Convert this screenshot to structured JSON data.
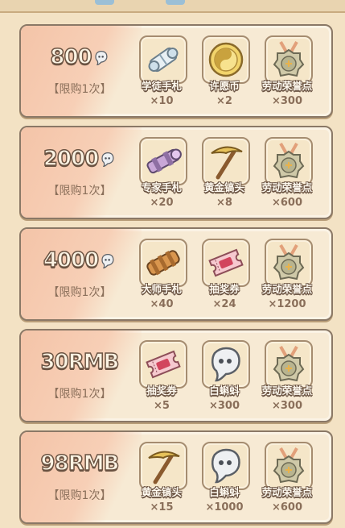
{
  "packs": [
    {
      "price": "800",
      "limit": "【限购1次】",
      "rewards": [
        {
          "icon": "scroll-icon",
          "name": "学徒手札",
          "qty": "×10"
        },
        {
          "icon": "coin-icon",
          "name": "许愿币",
          "qty": "×2"
        },
        {
          "icon": "medal-icon",
          "name": "劳动荣誉点",
          "qty": "×300"
        }
      ]
    },
    {
      "price": "2000",
      "limit": "【限购1次】",
      "rewards": [
        {
          "icon": "telescope-icon",
          "name": "专家手札",
          "qty": "×20"
        },
        {
          "icon": "pickaxe-icon",
          "name": "黄金镐头",
          "qty": "×8"
        },
        {
          "icon": "medal-icon",
          "name": "劳动荣誉点",
          "qty": "×600"
        }
      ]
    },
    {
      "price": "4000",
      "limit": "【限购1次】",
      "rewards": [
        {
          "icon": "master-scroll-icon",
          "name": "大师手札",
          "qty": "×40"
        },
        {
          "icon": "ticket-icon",
          "name": "抽奖券",
          "qty": "×24"
        },
        {
          "icon": "medal-icon",
          "name": "劳动荣誉点",
          "qty": "×1200"
        }
      ]
    },
    {
      "price": "30RMB",
      "limit": "【限购1次】",
      "rewards": [
        {
          "icon": "ticket-icon",
          "name": "抽奖券",
          "qty": "×5"
        },
        {
          "icon": "ghost-icon",
          "name": "白蝌蚪",
          "qty": "×300"
        },
        {
          "icon": "medal-icon",
          "name": "劳动荣誉点",
          "qty": "×300"
        }
      ]
    },
    {
      "price": "98RMB",
      "limit": "【限购1次】",
      "rewards": [
        {
          "icon": "pickaxe-icon",
          "name": "黄金镐头",
          "qty": "×15"
        },
        {
          "icon": "ghost-icon",
          "name": "白蝌蚪",
          "qty": "×1000"
        },
        {
          "icon": "medal-icon",
          "name": "劳动荣誉点",
          "qty": "×600"
        }
      ]
    }
  ]
}
